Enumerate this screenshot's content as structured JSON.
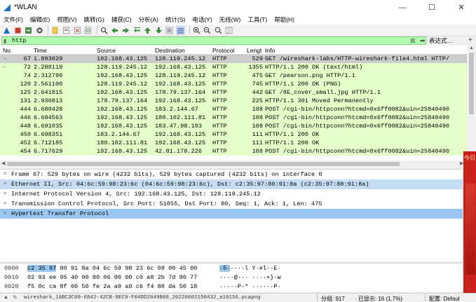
{
  "window": {
    "title": "*WLAN",
    "controls": [
      "—",
      "☐",
      "✕"
    ]
  },
  "menu": [
    "文件(F)",
    "编辑(E)",
    "视图(V)",
    "跳转(G)",
    "捕获(C)",
    "分析(A)",
    "统计(S)",
    "电话(Y)",
    "无线(W)",
    "工具(T)",
    "帮助(H)"
  ],
  "toolbar_icons": [
    "fin-icon",
    "stop-icon",
    "restart-icon",
    "options-icon",
    "open-icon",
    "save-icon",
    "close-file-icon",
    "reload-icon",
    "find-icon",
    "back-icon",
    "forward-icon",
    "goto-icon",
    "first-icon",
    "last-icon",
    "autoscroll-icon",
    "colorize-icon",
    "zoom-in-icon",
    "zoom-out-icon",
    "zoom-reset-icon",
    "resize-columns-icon"
  ],
  "filter": {
    "value": "http",
    "expression_label": "表达式…",
    "plus": "+"
  },
  "columns": [
    "No.",
    "Time",
    "Source",
    "Destination",
    "Protocol",
    "Lengt",
    "Info"
  ],
  "packets": [
    {
      "no": "67",
      "time": "1.893029",
      "src": "192.168.43.125",
      "dst": "128.119.245.12",
      "proto": "HTTP",
      "len": "529",
      "info": "GET /wireshark-labs/HTTP-wireshark-file4.html HTTP/",
      "selected": true,
      "marker": "→"
    },
    {
      "no": "72",
      "time": "2.288119",
      "src": "128.119.245.12",
      "dst": "192.168.43.125",
      "proto": "HTTP",
      "len": "1355",
      "info": "HTTP/1.1 200 OK  (text/html)",
      "marker": "←"
    },
    {
      "no": "74",
      "time": "2.312790",
      "src": "192.168.43.125",
      "dst": "128.119.245.12",
      "proto": "HTTP",
      "len": "475",
      "info": "GET /pearson.png HTTP/1.1"
    },
    {
      "no": "120",
      "time": "2.561100",
      "src": "128.119.245.12",
      "dst": "192.168.43.125",
      "proto": "HTTP",
      "len": "745",
      "info": "HTTP/1.1 200 OK  (PNG)"
    },
    {
      "no": "125",
      "time": "2.641815",
      "src": "192.168.43.125",
      "dst": "178.79.137.164",
      "proto": "HTTP",
      "len": "442",
      "info": "GET /8E_cover_small.jpg HTTP/1.1"
    },
    {
      "no": "131",
      "time": "2.930813",
      "src": "178.79.137.164",
      "dst": "192.168.43.125",
      "proto": "HTTP",
      "len": "225",
      "info": "HTTP/1.1 301 Moved Permanently"
    },
    {
      "no": "444",
      "time": "6.680428",
      "src": "192.168.43.125",
      "dst": "183.2.144.67",
      "proto": "HTTP",
      "len": "108",
      "info": "POST /cgi-bin/httpconn?htcmd=0x6ff0082&uin=25840490"
    },
    {
      "no": "446",
      "time": "6.684563",
      "src": "192.168.43.125",
      "dst": "180.102.111.81",
      "proto": "HTTP",
      "len": "108",
      "info": "POST /cgi-bin/httpconn?htcmd=0x6ff0082&uin=25840490"
    },
    {
      "no": "448",
      "time": "6.691035",
      "src": "192.168.43.125",
      "dst": "183.47.98.103",
      "proto": "HTTP",
      "len": "108",
      "info": "POST /cgi-bin/httpconn?htcmd=0x6ff0082&uin=25840490"
    },
    {
      "no": "450",
      "time": "6.698351",
      "src": "183.2.144.67",
      "dst": "192.168.43.125",
      "proto": "HTTP",
      "len": "111",
      "info": "HTTP/1.1 200 OK"
    },
    {
      "no": "452",
      "time": "6.712185",
      "src": "180.102.111.81",
      "dst": "192.168.43.125",
      "proto": "HTTP",
      "len": "111",
      "info": "HTTP/1.1 200 OK"
    },
    {
      "no": "454",
      "time": "6.717629",
      "src": "192.168.43.125",
      "dst": "42.81.178.226",
      "proto": "HTTP",
      "len": "108",
      "info": "POST /cgi-bin/httpconn?htcmd=0x6ff0082&uin=25840490"
    }
  ],
  "details": [
    {
      "text": "Frame 67: 529 bytes on wire (4232 bits), 529 bytes captured (4232 bits) on interface 0",
      "state": ""
    },
    {
      "text": "Ethernet II, Src: 04:6c:59:98:23:6c (04:6c:59:98:23:6c), Dst: c2:35:97:80:91:8a (c2:35:97:80:91:8a)",
      "state": "hl"
    },
    {
      "text": "Internet Protocol Version 4, Src: 192.168.43.125, Dst: 128.119.245.12",
      "state": ""
    },
    {
      "text": "Transmission Control Protocol, Src Port: 51855, Dst Port: 80, Seq: 1, Ack: 1, Len: 475",
      "state": ""
    },
    {
      "text": "Hypertext Transfer Protocol",
      "state": "sel"
    }
  ],
  "bytes": [
    {
      "offset": "0000",
      "hex_hl": "c2 35 97",
      "hex": " 80 91 8a 04 6c   59 98 23 6c 08 00 45 00",
      "ascii_hl": "·5·",
      "ascii": "····l Y·#l··E·"
    },
    {
      "offset": "0010",
      "hex_hl": "",
      "hex": "02 03 ee 95 40 00 80 06   00 00 c0 a8 2b 7d 80 77",
      "ascii_hl": "",
      "ascii": "····@···  ····+}·w"
    },
    {
      "offset": "0020",
      "hex_hl": "",
      "hex": "f5 0c ca 8f 00 50 fe 2a   a9 a0 c6 f4 88 da 50 18",
      "ascii_hl": "",
      "ascii": "·····P·*  ······P·"
    }
  ],
  "overlay_ad": {
    "text": "今日"
  },
  "status": {
    "file": "wireshark_1ABC3C09-6842-42CB-8EC9-F04DD2049B00_20220602150432_a10156.pcapng",
    "packets": "分组: 917",
    "displayed": "· 已显示: 16 (1.7%)",
    "profile": "配置: Defaul"
  }
}
